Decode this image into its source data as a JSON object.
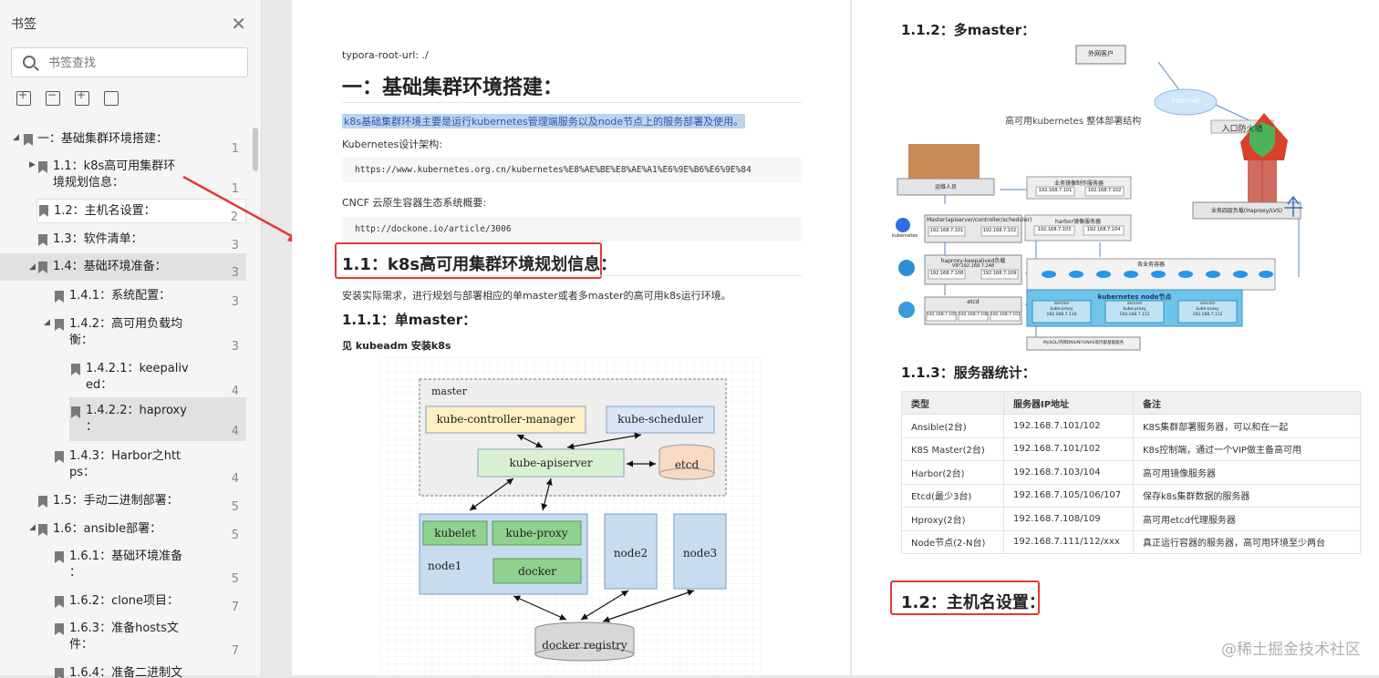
{
  "sidebar": {
    "title": "书签",
    "search_placeholder": "书签查找",
    "items": [
      {
        "label": "一：基础集群环境搭建：",
        "page": "1"
      },
      {
        "label": "1.1：k8s高可用集群环",
        "label2": "境规划信息：",
        "page": "1"
      },
      {
        "label": "1.2：主机名设置：",
        "page": "2"
      },
      {
        "label": "1.3：软件清单：",
        "page": "3"
      },
      {
        "label": "1.4：基础环境准备：",
        "page": "3"
      },
      {
        "label": "1.4.1：系统配置：",
        "page": "3"
      },
      {
        "label": "1.4.2：高可用负载均",
        "label2": "衡：",
        "page": "3"
      },
      {
        "label": "1.4.2.1：keepaliv",
        "label2": "ed：",
        "page": "4"
      },
      {
        "label": "1.4.2.2：haproxy",
        "label2": "：",
        "page": "4"
      },
      {
        "label": "1.4.3：Harbor之htt",
        "label2": "ps：",
        "page": "4"
      },
      {
        "label": "1.5：手动二进制部署：",
        "page": "5"
      },
      {
        "label": "1.6：ansible部署：",
        "page": "5"
      },
      {
        "label": "1.6.1：基础环境准备",
        "label2": "：",
        "page": "5"
      },
      {
        "label": "1.6.2：clone项目：",
        "page": "7"
      },
      {
        "label": "1.6.3：准备hosts文",
        "label2": "件：",
        "page": "7"
      },
      {
        "label": "1.6.4：准备二进制文",
        "page": ""
      }
    ]
  },
  "page1": {
    "meta": "typora-root-url: ./",
    "h1": "一：基础集群环境搭建：",
    "highlight": "k8s基础集群环境主要是运行kubernetes管理端服务以及node节点上的服务部署及使用。",
    "arch_label": "Kubernetes设计架构:",
    "arch_url": "https://www.kubernetes.org.cn/kubernetes%E8%AE%BE%E8%AE%A1%E6%9E%B6%E6%9E%84",
    "cncf_label": "CNCF 云原生容器生态系统概要:",
    "cncf_url": "http://dockone.io/article/3006",
    "h2": "1.1：k8s高可用集群环境规划信息：",
    "intro": "安装实际需求，进行规划与部署相应的单master或者多master的高可用k8s运行环境。",
    "h3": "1.1.1：单master：",
    "see": "见 kubeadm 安装k8s",
    "diagram": {
      "master": "master",
      "controller": "kube-controller-manager",
      "scheduler": "kube-scheduler",
      "apiserver": "kube-apiserver",
      "etcd": "etcd",
      "kubelet": "kubelet",
      "proxy": "kube-proxy",
      "docker": "docker",
      "node1": "node1",
      "node2": "node2",
      "node3": "node3",
      "registry": "docker registry"
    }
  },
  "page2": {
    "h3_multi": "1.1.2：多master：",
    "diagram": {
      "title": "高可用kubernetes 整体部署结构",
      "client": "外网客户",
      "internet": "Internet",
      "firewall": "入口防火墙",
      "lb": "业务四层负载(Haproxy/LVS)",
      "ops": "运维人员",
      "k8s_logo": "kubernetes",
      "master": "Master(apiserver/controller/scheduler)",
      "m_ip1": "192.168.7.101",
      "m_ip2": "192.168.7.102",
      "mirror": "业务镜像制作服务器",
      "mirror_ip1": "192.168.7.101",
      "mirror_ip2": "192.168.7.102",
      "harbor": "harbor镜像服务器",
      "h_ip1": "192.168.7.103",
      "h_ip2": "192.168.7.104",
      "haproxy": "haproxy-keepalived负载",
      "vip": "VIP:192.168.7.248",
      "hp_ip1": "192.168.7.108",
      "hp_ip2": "192.168.7.109",
      "etcd": "etcd",
      "e_ip1": "192.168.7.105",
      "e_ip2": "192.168.7.106",
      "e_ip3": "192.168.7.107",
      "containers": "各业务容器",
      "node_title": "kubernetes node节点",
      "node_line1": "service",
      "node_line2": "kube-proxy",
      "node_ip1": "192.168.7.110",
      "node_ip2": "192.168.7.111",
      "node_ip3": "192.168.7.112",
      "storage": "MySQL/内网DNS/NFS/NAS等内部基础服务"
    },
    "h3_servers": "1.1.3：服务器统计：",
    "table": {
      "headers": [
        "类型",
        "服务器IP地址",
        "备注"
      ],
      "rows": [
        [
          "Ansible(2台)",
          "192.168.7.101/102",
          "K8S集群部署服务器，可以和在一起"
        ],
        [
          "K8S Master(2台)",
          "192.168.7.101/102",
          "K8s控制端，通过一个VIP做主备高可用"
        ],
        [
          "Harbor(2台)",
          "192.168.7.103/104",
          "高可用镜像服务器"
        ],
        [
          "Etcd(最少3台)",
          "192.168.7.105/106/107",
          "保存k8s集群数据的服务器"
        ],
        [
          "Hproxy(2台)",
          "192.168.7.108/109",
          "高可用etcd代理服务器"
        ],
        [
          "Node节点(2-N台)",
          "192.168.7.111/112/xxx",
          "真正运行容器的服务器，高可用环境至少两台"
        ]
      ]
    },
    "h2": "1.2：主机名设置："
  },
  "watermark": "@稀土掘金技术社区",
  "colors": {
    "annotation_red": "#e53935",
    "highlight_bg": "#bcd4ee",
    "sidebar_bg": "#f5f5f5"
  }
}
